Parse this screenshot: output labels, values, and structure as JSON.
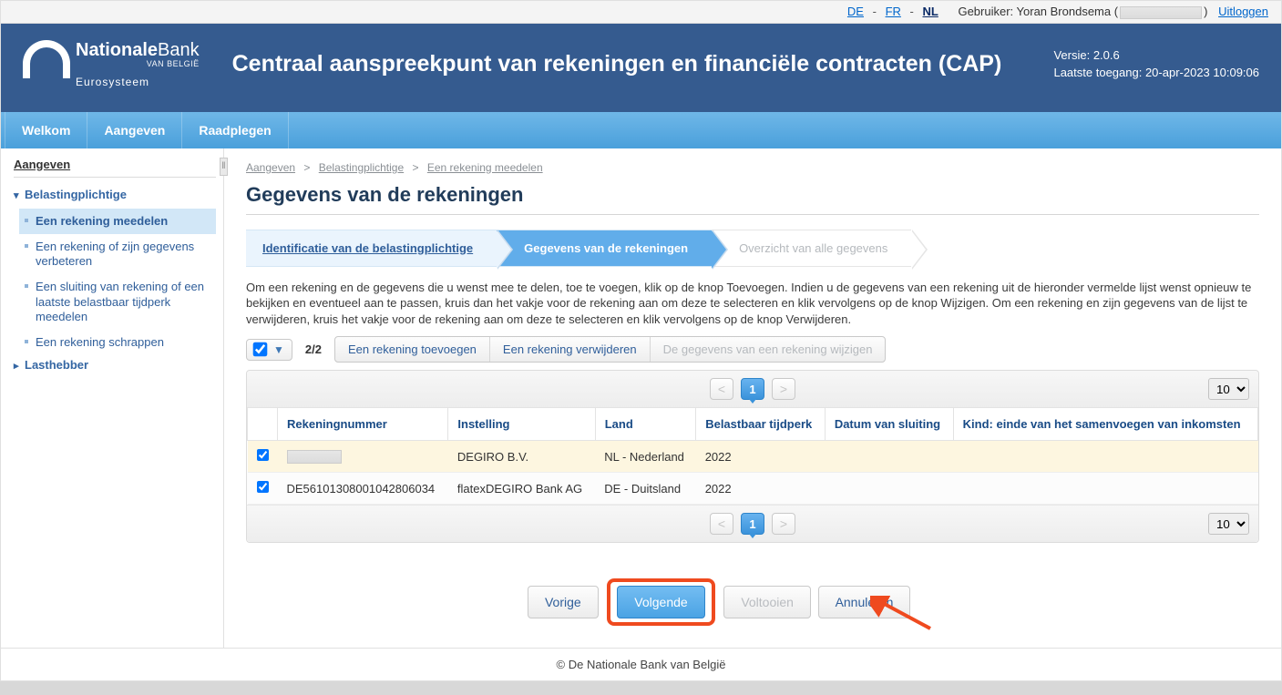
{
  "topbar": {
    "lang_de": "DE",
    "lang_fr": "FR",
    "lang_nl": "NL",
    "user_prefix": "Gebruiker: ",
    "user_name": "Yoran Brondsema",
    "logout": "Uitloggen"
  },
  "banner": {
    "bank_name_bold": "Nationale",
    "bank_name_rest": "Bank",
    "bank_sub1": "VAN BELGIË",
    "bank_sub2": "Eurosysteem",
    "title": "Centraal aanspreekpunt van rekeningen en financiële contracten (CAP)",
    "version_label": "Versie: ",
    "version": "2.0.6",
    "last_access_label": "Laatste toegang: ",
    "last_access": "20-apr-2023 10:09:06"
  },
  "tabs": {
    "welkom": "Welkom",
    "aangeven": "Aangeven",
    "raadplegen": "Raadplegen"
  },
  "sidebar": {
    "heading": "Aangeven",
    "node1": "Belastingplichtige",
    "items": [
      "Een rekening meedelen",
      "Een rekening of zijn gegevens verbeteren",
      "Een sluiting van rekening of een laatste belastbaar tijdperk meedelen",
      "Een rekening schrappen"
    ],
    "node2": "Lasthebber"
  },
  "crumbs": {
    "c1": "Aangeven",
    "c2": "Belastingplichtige",
    "c3": "Een rekening meedelen"
  },
  "page_heading": "Gegevens van de rekeningen",
  "wizard": {
    "s1": "Identificatie van de belastingplichtige",
    "s2": "Gegevens van de rekeningen",
    "s3": "Overzicht van alle gegevens"
  },
  "instructions": "Om een rekening en de gegevens die u wenst mee te delen, toe te voegen, klik op de knop Toevoegen. Indien u de gegevens van een rekening uit de hieronder vermelde lijst wenst opnieuw te bekijken en eventueel aan te passen, kruis dan het vakje voor de rekening aan om deze te selecteren en klik vervolgens op de knop Wijzigen. Om een rekening en zijn gegevens van de lijst te verwijderen, kruis het vakje voor de rekening aan om deze te selecteren en klik vervolgens op de knop Verwijderen.",
  "toolbar": {
    "counter": "2/2",
    "add": "Een rekening toevoegen",
    "remove": "Een rekening verwijderen",
    "edit": "De gegevens van een rekening wijzigen"
  },
  "table": {
    "headers": {
      "number": "Rekeningnummer",
      "inst": "Instelling",
      "country": "Land",
      "period": "Belastbaar tijdperk",
      "closed": "Datum van sluiting",
      "kind": "Kind: einde van het samenvoegen van inkomsten"
    },
    "rows": [
      {
        "number": "",
        "redacted": true,
        "inst": "DEGIRO B.V.",
        "country": "NL - Nederland",
        "period": "2022",
        "closed": "",
        "kind": ""
      },
      {
        "number": "DE56101308001042806034",
        "redacted": false,
        "inst": "flatexDEGIRO Bank AG",
        "country": "DE - Duitsland",
        "period": "2022",
        "closed": "",
        "kind": ""
      }
    ],
    "page_current": "1",
    "page_size": "10"
  },
  "actions": {
    "prev": "Vorige",
    "next": "Volgende",
    "finish": "Voltooien",
    "cancel": "Annuleren"
  },
  "footer": "© De Nationale Bank van België"
}
